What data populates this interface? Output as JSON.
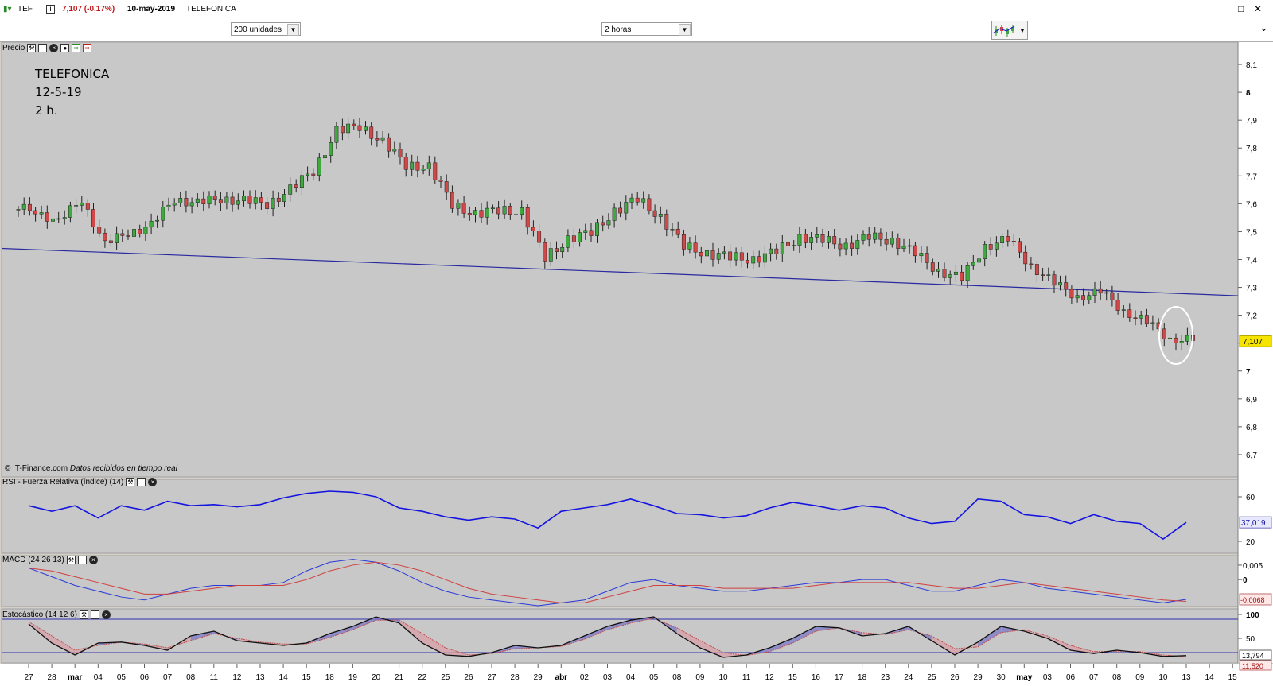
{
  "app": {
    "ticker": "TEF",
    "price_change": "7,107 (-0,17%)",
    "date": "10-may-2019",
    "name": "TELEFONICA"
  },
  "toolbar": {
    "units": "200 unidades",
    "interval": "2 horas"
  },
  "panes": {
    "price_label": "Precio",
    "rsi_label": "RSI - Fuerza Relativa (índice) (14)",
    "macd_label": "MACD (24 26 13)",
    "stoch_label": "Estocástico (14 12 6)"
  },
  "annotation": {
    "line1": "TELEFONICA",
    "line2": "12-5-19",
    "line3": "2 h."
  },
  "credit": {
    "source": "© IT-Finance.com",
    "note": "Datos recibidos en tiempo real"
  },
  "price_axis": {
    "ticks": [
      "8,1",
      "8",
      "7,9",
      "7,8",
      "7,7",
      "7,6",
      "7,5",
      "7,4",
      "7,3",
      "7,2",
      "7,1",
      "7",
      "6,9",
      "6,8",
      "6,7"
    ],
    "last_value": "7,107"
  },
  "rsi_axis": {
    "ticks": [
      "60",
      "20"
    ],
    "last_value": "37,019"
  },
  "macd_axis": {
    "ticks": [
      "0,005",
      "0"
    ],
    "last_value": "-0,0068"
  },
  "stoch_axis": {
    "ticks": [
      "100",
      "50"
    ],
    "last_k": "13,794",
    "last_d": "11,520"
  },
  "x_axis": {
    "labels": [
      "27",
      "28",
      "mar",
      "04",
      "05",
      "06",
      "07",
      "08",
      "11",
      "12",
      "13",
      "14",
      "15",
      "18",
      "19",
      "20",
      "21",
      "22",
      "25",
      "26",
      "27",
      "28",
      "29",
      "abr",
      "02",
      "03",
      "04",
      "05",
      "08",
      "09",
      "10",
      "11",
      "12",
      "15",
      "16",
      "17",
      "18",
      "23",
      "24",
      "25",
      "26",
      "29",
      "30",
      "may",
      "03",
      "06",
      "07",
      "08",
      "09",
      "10",
      "13",
      "14",
      "15"
    ],
    "bold": [
      "mar",
      "abr",
      "may"
    ]
  },
  "colors": {
    "pane_bg": "#c8c8c8",
    "up_candle": "#3fa83f",
    "down_candle": "#d04848",
    "trendline": "#2a2aa0",
    "rsi_line": "#1414e0",
    "macd_line": "#2a3ad8",
    "signal_line": "#d04040",
    "price_tag": "#f5e400"
  },
  "chart_data": [
    {
      "type": "candlestick",
      "title": "Precio",
      "x": [
        "27",
        "28",
        "mar",
        "04",
        "05",
        "06",
        "07",
        "08",
        "11",
        "12",
        "13",
        "14",
        "15",
        "18",
        "19",
        "20",
        "21",
        "22",
        "25",
        "26",
        "27",
        "28",
        "29",
        "abr",
        "02",
        "03",
        "04",
        "05",
        "08",
        "09",
        "10",
        "11",
        "12",
        "15",
        "16",
        "17",
        "18",
        "23",
        "24",
        "25",
        "26",
        "29",
        "30",
        "may",
        "03",
        "06",
        "07",
        "08",
        "09",
        "10",
        "13"
      ],
      "close": [
        7.58,
        7.53,
        7.62,
        7.45,
        7.5,
        7.52,
        7.62,
        7.6,
        7.62,
        7.61,
        7.6,
        7.65,
        7.72,
        7.86,
        7.88,
        7.82,
        7.74,
        7.73,
        7.6,
        7.56,
        7.58,
        7.57,
        7.41,
        7.47,
        7.5,
        7.57,
        7.62,
        7.55,
        7.45,
        7.42,
        7.41,
        7.4,
        7.43,
        7.48,
        7.47,
        7.45,
        7.48,
        7.47,
        7.42,
        7.36,
        7.33,
        7.45,
        7.47,
        7.38,
        7.31,
        7.27,
        7.28,
        7.22,
        7.17,
        7.12,
        7.107
      ],
      "ylim": [
        6.62,
        8.18
      ],
      "trendline": [
        [
          0,
          7.44
        ],
        [
          53,
          7.27
        ]
      ],
      "last": 7.107
    },
    {
      "type": "line",
      "title": "RSI - Fuerza Relativa (índice) (14)",
      "series": [
        {
          "values": [
            52,
            47,
            52,
            41,
            52,
            48,
            56,
            52,
            53,
            51,
            53,
            59,
            63,
            65,
            64,
            60,
            50,
            47,
            42,
            39,
            42,
            40,
            32,
            47,
            50,
            53,
            58,
            52,
            45,
            44,
            41,
            43,
            50,
            55,
            52,
            48,
            52,
            50,
            41,
            36,
            38,
            58,
            56,
            44,
            42,
            36,
            44,
            38,
            36,
            22,
            37.019
          ]
        }
      ],
      "ylim": [
        10,
        75
      ]
    },
    {
      "type": "line",
      "title": "MACD (24 26 13)",
      "series": [
        {
          "name": "MACD",
          "values": [
            0.004,
            0.001,
            -0.002,
            -0.004,
            -0.006,
            -0.007,
            -0.005,
            -0.003,
            -0.002,
            -0.002,
            -0.002,
            -0.001,
            0.003,
            0.006,
            0.007,
            0.006,
            0.003,
            -0.001,
            -0.004,
            -0.006,
            -0.007,
            -0.008,
            -0.009,
            -0.008,
            -0.007,
            -0.004,
            -0.001,
            0.0,
            -0.002,
            -0.003,
            -0.004,
            -0.004,
            -0.003,
            -0.002,
            -0.001,
            -0.001,
            0.0,
            0.0,
            -0.002,
            -0.004,
            -0.004,
            -0.002,
            0.0,
            -0.001,
            -0.003,
            -0.004,
            -0.005,
            -0.006,
            -0.007,
            -0.008,
            -0.0068
          ]
        },
        {
          "name": "Señal",
          "values": [
            0.004,
            0.003,
            0.001,
            -0.001,
            -0.003,
            -0.005,
            -0.005,
            -0.004,
            -0.003,
            -0.002,
            -0.002,
            -0.002,
            0.0,
            0.003,
            0.005,
            0.006,
            0.005,
            0.003,
            0.0,
            -0.003,
            -0.005,
            -0.006,
            -0.007,
            -0.008,
            -0.008,
            -0.006,
            -0.004,
            -0.002,
            -0.002,
            -0.002,
            -0.003,
            -0.003,
            -0.003,
            -0.003,
            -0.002,
            -0.001,
            -0.001,
            -0.001,
            -0.001,
            -0.002,
            -0.003,
            -0.003,
            -0.002,
            -0.001,
            -0.002,
            -0.003,
            -0.004,
            -0.005,
            -0.006,
            -0.007,
            -0.0075
          ]
        }
      ],
      "ylim": [
        -0.009,
        0.008
      ]
    },
    {
      "type": "line",
      "title": "Estocástico (14 12 6)",
      "series": [
        {
          "name": "K",
          "values": [
            80,
            40,
            15,
            40,
            42,
            35,
            25,
            55,
            65,
            45,
            40,
            35,
            40,
            60,
            75,
            95,
            82,
            40,
            15,
            12,
            20,
            35,
            30,
            35,
            55,
            75,
            88,
            95,
            60,
            30,
            10,
            15,
            30,
            50,
            75,
            72,
            55,
            60,
            75,
            45,
            15,
            42,
            75,
            65,
            50,
            25,
            18,
            25,
            20,
            12,
            13.794
          ]
        },
        {
          "name": "D",
          "values": [
            85,
            55,
            25,
            35,
            42,
            38,
            30,
            45,
            60,
            50,
            42,
            38,
            38,
            52,
            68,
            88,
            88,
            60,
            30,
            15,
            18,
            28,
            30,
            33,
            48,
            68,
            82,
            92,
            72,
            45,
            20,
            14,
            22,
            40,
            65,
            72,
            62,
            58,
            68,
            55,
            28,
            32,
            62,
            68,
            55,
            35,
            22,
            23,
            22,
            15,
            11.52
          ]
        }
      ],
      "ylim": [
        0,
        110
      ]
    }
  ]
}
